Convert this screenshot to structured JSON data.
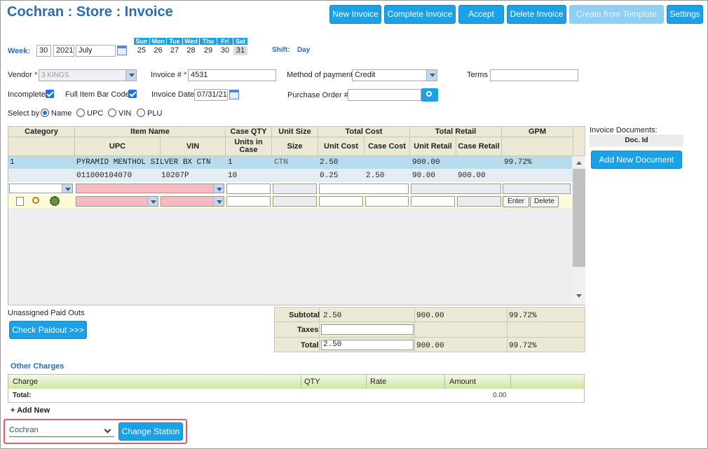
{
  "header": {
    "title": "Cochran : Store : Invoice",
    "buttons": {
      "new_invoice": "New Invoice",
      "complete_invoice": "Complete Invoice",
      "accept": "Accept",
      "delete_invoice": "Delete Invoice",
      "create_from_template": "Create from Template",
      "settings": "Settings"
    }
  },
  "week": {
    "label": "Week:",
    "day": "30",
    "year": "2021",
    "month": "July",
    "days": [
      {
        "h": "Sun",
        "n": "25"
      },
      {
        "h": "Mon",
        "n": "26"
      },
      {
        "h": "Tue",
        "n": "27"
      },
      {
        "h": "Wed",
        "n": "28"
      },
      {
        "h": "Thu",
        "n": "29"
      },
      {
        "h": "Fri",
        "n": "30"
      },
      {
        "h": "Sat",
        "n": "31"
      }
    ],
    "shift_label": "Shift:",
    "shift_value": "Day"
  },
  "form": {
    "vendor_label": "Vendor",
    "vendor_value": "3 KINGS",
    "invoice_no_label": "Invoice #",
    "invoice_no_value": "4531",
    "payment_label": "Method of payment",
    "payment_value": "Credit",
    "terms_label": "Terms",
    "terms_value": "",
    "incomplete_label": "Incomplete",
    "full_barcode_label": "Full Item Bar Code",
    "invoice_date_label": "Invoice Date",
    "invoice_date_value": "07/31/21",
    "po_label": "Purchase Order #",
    "po_value": "",
    "select_by_label": "Select by",
    "select_options": [
      "Name",
      "UPC",
      "VIN",
      "PLU"
    ],
    "required_mark": "*"
  },
  "grid": {
    "headers": {
      "category": "Category",
      "item_name": "Item Name",
      "case_qty": "Case QTY",
      "unit_size": "Unit Size",
      "total_cost": "Total Cost",
      "total_retail": "Total Retail",
      "gpm": "GPM",
      "upc": "UPC",
      "vin": "VIN",
      "units_in_case": "Units in Case",
      "size": "Size",
      "unit_cost": "Unit Cost",
      "case_cost": "Case Cost",
      "unit_retail": "Unit Retail",
      "case_retail": "Case Retail"
    },
    "row1": {
      "category": "1",
      "item_name": "PYRAMID MENTHOL SILVER BX CTN",
      "case_qty": "1",
      "unit_size": "CTN",
      "total_cost": "2.50",
      "total_retail": "900.00",
      "gpm": "99.72%"
    },
    "row2": {
      "upc": "011000104070",
      "vin": "10207P",
      "units": "10",
      "unit_cost": "0.25",
      "case_cost": "2.50",
      "unit_retail": "90.00",
      "case_retail": "900.00"
    },
    "enter_label": "Enter",
    "delete_label": "Delete"
  },
  "paidouts": {
    "label": "Unassigned Paid Outs",
    "button": "Check Paidout >>>"
  },
  "totals": {
    "subtotal_label": "Subtotal",
    "subtotal_cost": "2.50",
    "subtotal_retail": "900.00",
    "subtotal_gpm": "99.72%",
    "taxes_label": "Taxes",
    "total_label": "Total",
    "total_cost": "2.50",
    "total_retail": "900.00",
    "total_gpm": "99.72%"
  },
  "documents": {
    "label": "Invoice Documents:",
    "doc_id_header": "Doc. Id",
    "add_button": "Add New Document"
  },
  "other_charges": {
    "title": "Other Charges",
    "headers": [
      "Charge",
      "QTY",
      "Rate",
      "Amount"
    ],
    "total_label": "Total:",
    "total_value": "0.00",
    "add_new": "+ Add New"
  },
  "station": {
    "value": "Cochran",
    "button": "Change Station"
  }
}
